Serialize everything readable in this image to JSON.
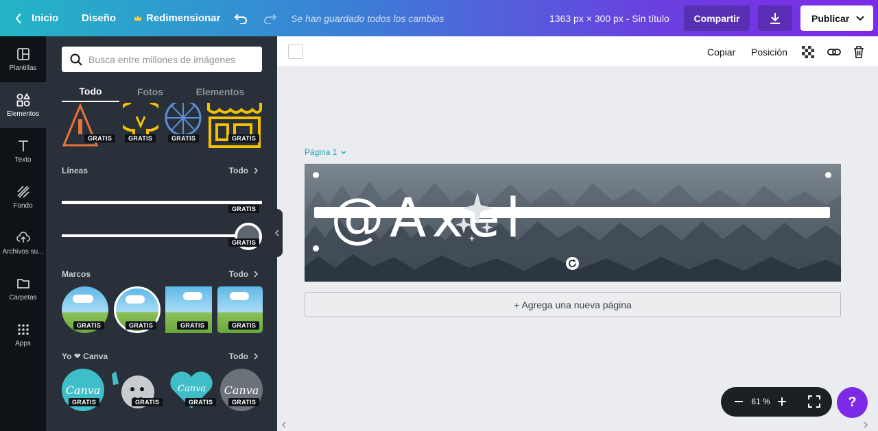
{
  "topbar": {
    "back_label": "Inicio",
    "design_label": "Diseño",
    "resize_label": "Redimensionar",
    "saved_status": "Se han guardado todos los cambios",
    "dimensions": "1363 px × 300 px - Sin título",
    "share_label": "Compartir",
    "publish_label": "Publicar"
  },
  "rail": {
    "items": [
      {
        "label": "Plantillas",
        "icon": "templates-icon"
      },
      {
        "label": "Elementos",
        "icon": "elements-icon"
      },
      {
        "label": "Texto",
        "icon": "text-icon"
      },
      {
        "label": "Fondo",
        "icon": "background-icon"
      },
      {
        "label": "Archivos su...",
        "icon": "upload-icon"
      },
      {
        "label": "Carpetas",
        "icon": "folder-icon"
      },
      {
        "label": "Apps",
        "icon": "apps-icon"
      }
    ]
  },
  "panel": {
    "search_placeholder": "Busca entre millones de imágenes",
    "tabs": [
      "Todo",
      "Fotos",
      "Elementos"
    ],
    "free_badge": "GRATIS",
    "sections": {
      "lines": {
        "title": "Líneas",
        "link": "Todo"
      },
      "frames": {
        "title": "Marcos",
        "link": "Todo"
      },
      "love": {
        "title": "Yo ❤ Canva",
        "link": "Todo"
      }
    },
    "love_items": [
      "Canva",
      "Canva",
      "Canva"
    ]
  },
  "editor": {
    "copy_label": "Copiar",
    "position_label": "Posición",
    "page_label": "Página 1",
    "canvas_text": "@Axel",
    "add_page_label": "+ Agrega una nueva página",
    "zoom_value": "61 %",
    "help_label": "?"
  },
  "colors": {
    "accent": "#7d2ae8",
    "panel_bg": "#293039",
    "rail_bg": "#0e1318",
    "page_label": "#1aa3b8"
  }
}
